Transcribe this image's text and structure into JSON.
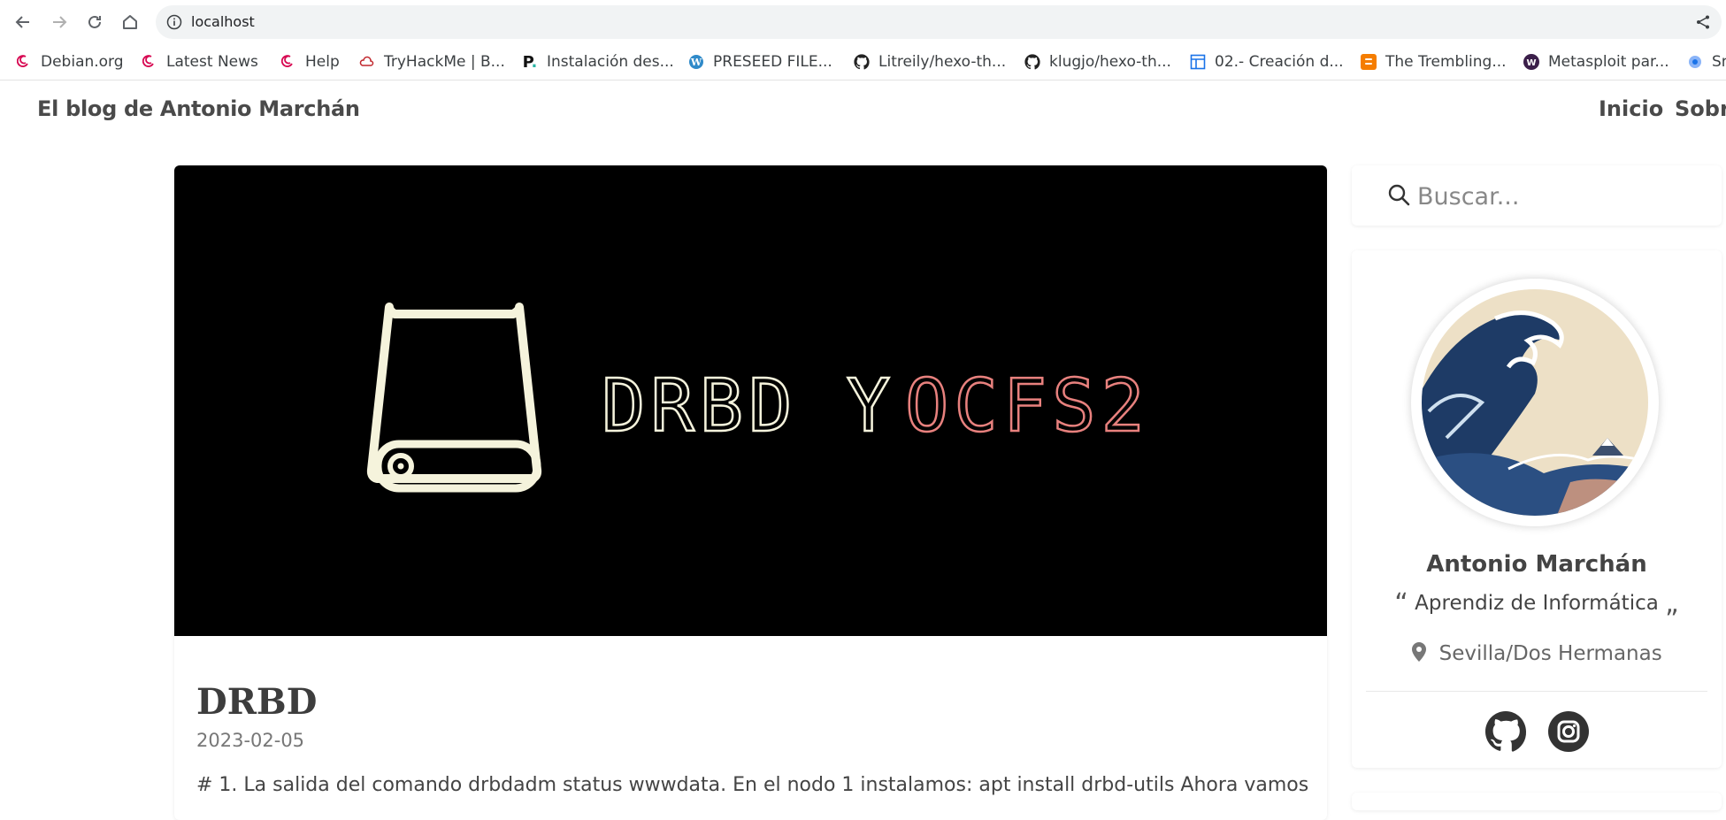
{
  "browser": {
    "url": "localhost",
    "bookmarks": [
      {
        "label": "Debian.org",
        "icon": "debian-swirl-icon"
      },
      {
        "label": "Latest News",
        "icon": "debian-swirl-icon"
      },
      {
        "label": "Help",
        "icon": "debian-swirl-icon"
      },
      {
        "label": "TryHackMe | B...",
        "icon": "tryhackme-icon"
      },
      {
        "label": "Instalación des...",
        "icon": "p-logo-icon"
      },
      {
        "label": "PRESEED FILE...",
        "icon": "wordpress-icon"
      },
      {
        "label": "Litreily/hexo-th...",
        "icon": "github-icon"
      },
      {
        "label": "klugjo/hexo-th...",
        "icon": "github-icon"
      },
      {
        "label": "02.- Creación d...",
        "icon": "layout-icon"
      },
      {
        "label": "The Trembling...",
        "icon": "blogger-icon"
      },
      {
        "label": "Metasploit par...",
        "icon": "w-circle-icon"
      },
      {
        "label": "Sn",
        "icon": "blue-circle-icon"
      }
    ]
  },
  "site": {
    "brand": "El blog de Antonio Marchán",
    "menu": [
      "Inicio",
      "Sobre"
    ]
  },
  "post": {
    "hero_text_a": "DRBD Y ",
    "hero_text_b": "OCFS2",
    "title": "DRBD",
    "date": "2023-02-05",
    "excerpt": "# 1. La salida del comando drbdadm status wwwdata. En el nodo 1 instalamos: apt install drbd-utils Ahora vamos"
  },
  "sidebar": {
    "search_placeholder": "Buscar...",
    "profile": {
      "name": "Antonio Marchán",
      "tagline": "Aprendiz de Informática",
      "quote_open": "“",
      "quote_close": "„",
      "location": "Sevilla/Dos Hermanas"
    },
    "social": [
      "github-icon",
      "instagram-icon"
    ]
  },
  "colors": {
    "hero_bg": "#000000",
    "hero_cream": "#f5f3dc",
    "hero_salmon": "#e8817e",
    "text_dark": "#4a4a4a"
  }
}
